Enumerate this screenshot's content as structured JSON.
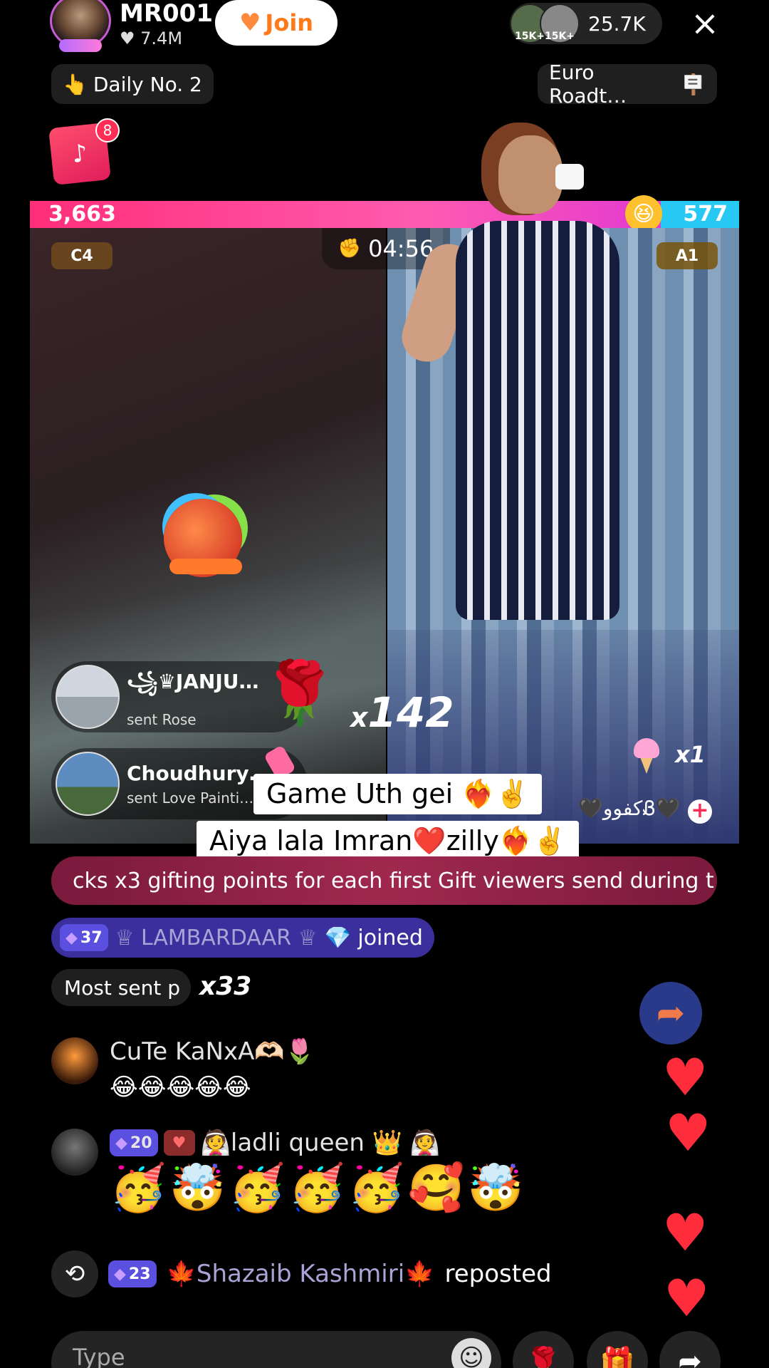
{
  "header": {
    "host_name": "MR001",
    "host_likes": "7.4M",
    "join_label": "Join",
    "viewer_badges": [
      "15K+",
      "15K+"
    ],
    "viewer_count": "25.7K",
    "close_icon": "×"
  },
  "pills": {
    "daily": "Daily No. 2",
    "euro": "Euro Roadt…"
  },
  "gift_box_badge": "8",
  "battle": {
    "left_score": "3,663",
    "right_score": "577",
    "timer": "04:56",
    "left_tag": "C4",
    "right_tag": "A1"
  },
  "gifts": [
    {
      "name": "꧁♛JANJU…",
      "action": "sent Rose"
    },
    {
      "name": "Choudhury…",
      "action": "sent Love Painti…"
    }
  ],
  "combo": {
    "prefix": "x",
    "count": "142"
  },
  "right_gift": {
    "count": "x1",
    "user": "🖤كفووᏰ🖤"
  },
  "captions": [
    "Game Uth gei ❤️‍🔥✌️",
    "Aiya lala Imran❤️zilly❤️‍🔥✌️"
  ],
  "promo_text": "cks x3 gifting points for each first Gift viewers send during t",
  "joined": {
    "level": "37",
    "name": "♕ LAMBARDAAR ♕",
    "suffix": "💎 joined"
  },
  "most_sent": {
    "label": "Most sent p",
    "count": "x33"
  },
  "comments": [
    {
      "name": "CuTe KaNxA🫶🏻🌷",
      "text": "😂😂😂😂😂"
    },
    {
      "level": "20",
      "name": "👰ladli queen 👑 👰",
      "text": "🥳🤯🥳🥳🥳🥰🤯"
    }
  ],
  "repost": {
    "level": "23",
    "name": "🍁Shazaib Kashmiri🍁",
    "suffix": "reposted"
  },
  "input": {
    "placeholder": "Type"
  },
  "colors": {
    "battle_pink": "#ff2e79",
    "battle_blue": "#27c9f4",
    "join_orange": "#ff7a1a",
    "joined_bg": "#3a2f9c"
  },
  "icons": [
    "heart-icon",
    "close-icon",
    "fire-icon",
    "signpost-icon",
    "gift-box-icon",
    "boxing-gloves-icon",
    "rose-icon",
    "ice-cream-icon",
    "plus-icon",
    "share-icon",
    "repost-icon",
    "emoji-icon",
    "gift-icon"
  ]
}
